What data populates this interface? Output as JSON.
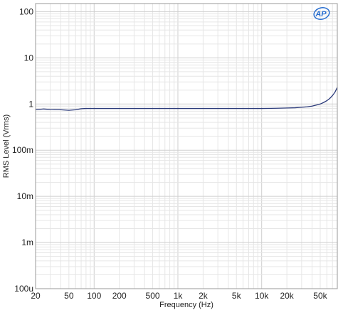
{
  "chart_data": {
    "type": "line",
    "title": "",
    "xlabel": "Frequency (Hz)",
    "ylabel": "RMS Level (Vrms)",
    "x_scale": "log",
    "y_scale": "log",
    "xlim": [
      20,
      80000
    ],
    "ylim": [
      0.0001,
      150
    ],
    "grid": true,
    "x_ticks": [
      20,
      50,
      100,
      200,
      500,
      1000,
      2000,
      5000,
      10000,
      20000,
      50000
    ],
    "x_tick_labels": [
      "20",
      "50",
      "100",
      "200",
      "500",
      "1k",
      "2k",
      "5k",
      "10k",
      "20k",
      "50k"
    ],
    "y_ticks": [
      100,
      10,
      1,
      0.1,
      0.01,
      0.001,
      0.0001
    ],
    "y_tick_labels": [
      "100",
      "10",
      "1",
      "100m",
      "10m",
      "1m",
      "100u"
    ],
    "series": [
      {
        "color": "#2b3a7a",
        "x": [
          20,
          25,
          30,
          40,
          50,
          60,
          70,
          80,
          100,
          200,
          500,
          1000,
          2000,
          5000,
          10000,
          15000,
          20000,
          25000,
          30000,
          35000,
          40000,
          45000,
          50000,
          55000,
          60000,
          65000,
          70000,
          75000,
          80000
        ],
        "y": [
          0.75,
          0.78,
          0.76,
          0.75,
          0.73,
          0.75,
          0.79,
          0.8,
          0.8,
          0.8,
          0.8,
          0.8,
          0.8,
          0.8,
          0.8,
          0.81,
          0.82,
          0.83,
          0.85,
          0.87,
          0.9,
          0.95,
          1.0,
          1.08,
          1.18,
          1.32,
          1.52,
          1.8,
          2.3
        ]
      }
    ]
  },
  "logo": {
    "text": "AP",
    "color": "#2a6fd0"
  }
}
